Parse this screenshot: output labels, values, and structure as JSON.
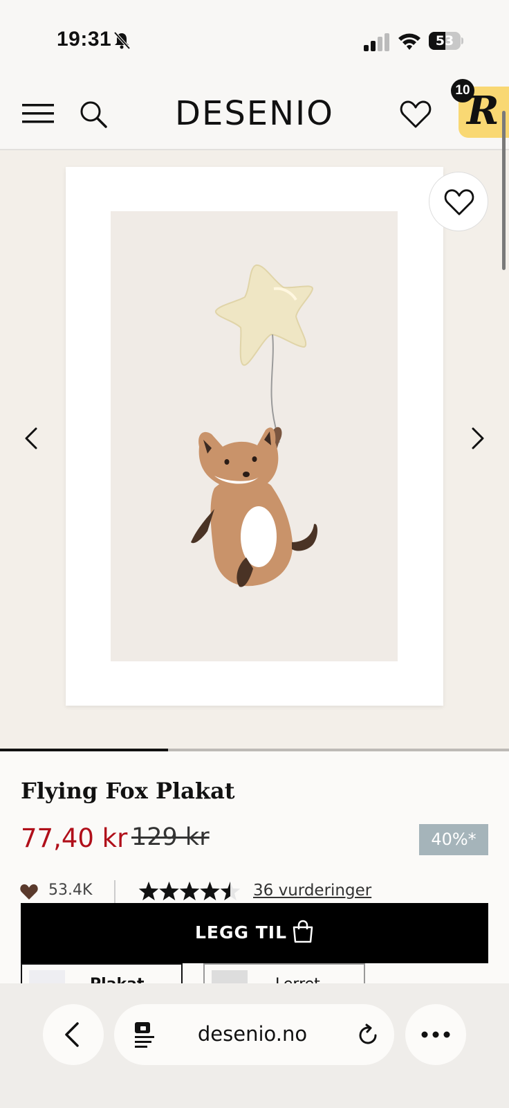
{
  "status_bar": {
    "time": "19:31",
    "battery": "53",
    "battery_level": 0.53
  },
  "header": {
    "logo": "DESENIO",
    "rewards_badge": "10",
    "rewards_mark": "R"
  },
  "gallery": {
    "progress": 0.33
  },
  "product": {
    "title": "Flying Fox Plakat",
    "price_sale": "77,40 kr",
    "price_original": "129 kr",
    "discount": "40%*",
    "likes": "53.4K",
    "rating": 4.5,
    "reviews_link": "36 vurderinger",
    "add_to_cart": "LEGG TIL",
    "format_tabs": [
      {
        "label": "Plakat"
      },
      {
        "label": "Lerret"
      }
    ]
  },
  "browser": {
    "url": "desenio.no"
  },
  "colors": {
    "sale_red": "#b00f1a",
    "discount_badge": "#a5b4ba",
    "rewards_yellow": "#f9d873",
    "button_black": "#000000"
  },
  "icons": [
    "bell-muted-icon",
    "signal-icon",
    "wifi-icon",
    "battery-icon",
    "menu-icon",
    "search-icon",
    "heart-icon",
    "chevron-left-icon",
    "chevron-right-icon",
    "bag-icon",
    "star-icon",
    "reader-icon",
    "reload-icon",
    "more-icon"
  ]
}
